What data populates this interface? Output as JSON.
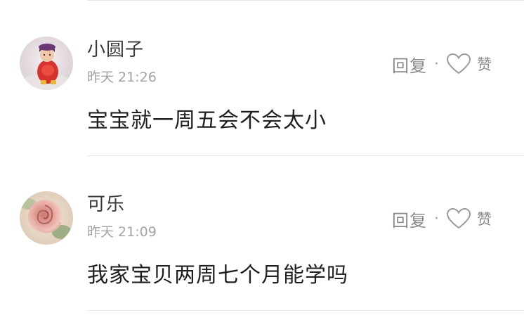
{
  "comments": [
    {
      "username": "小圆子",
      "time": "昨天 21:26",
      "content": "宝宝就一周五会不会太小",
      "reply_label": "回复",
      "separator": "·",
      "like_label": "赞",
      "avatar_icon": "baby-photo-avatar"
    },
    {
      "username": "可乐",
      "time": "昨天 21:09",
      "content": "我家宝贝两周七个月能学吗",
      "reply_label": "回复",
      "separator": "·",
      "like_label": "赞",
      "avatar_icon": "rose-photo-avatar"
    }
  ],
  "colors": {
    "divider": "#e6e6e6",
    "meta_text": "#a3a3a3",
    "action_text": "#8a8a8a"
  }
}
